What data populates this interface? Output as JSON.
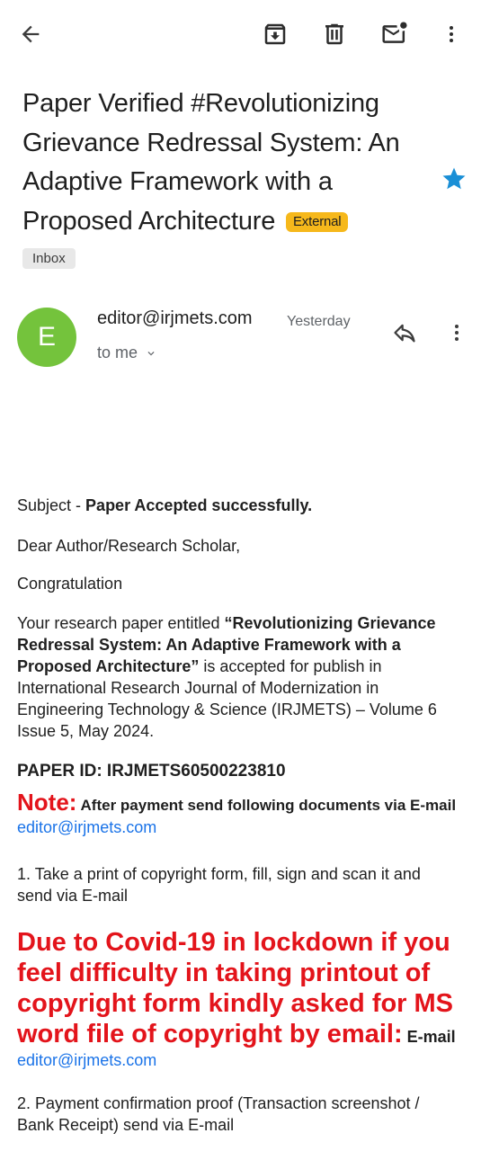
{
  "toolbar": {
    "back_icon": "arrow-back-icon",
    "archive_icon": "archive-icon",
    "delete_icon": "trash-icon",
    "mark_unread_icon": "mail-unread-icon",
    "more_icon": "more-vert-icon"
  },
  "email": {
    "subject": "Paper Verified #Revolutionizing Grievance Redressal System: An Adaptive Framework with a Proposed Architecture",
    "external_label": "External",
    "label_chip": "Inbox",
    "starred": true,
    "star_color": "#1a8fd6"
  },
  "sender": {
    "avatar_letter": "E",
    "avatar_color": "#74c33c",
    "address": "editor@irjmets.com",
    "time": "Yesterday",
    "to": "to me"
  },
  "body": {
    "subject_prefix": "Subject - ",
    "subject_bold": "Paper Accepted successfully.",
    "greeting": "Dear Author/Research Scholar,",
    "congrats": "Congratulation",
    "para_start": "Your research paper entitled ",
    "para_title": "“Revolutionizing Grievance Redressal System: An Adaptive Framework with a Proposed Architecture”",
    "para_end": " is accepted for publish in International Research Journal of Modernization in Engineering Technology & Science (IRJMETS) – Volume 6 Issue 5, May 2024.",
    "paper_id": "PAPER ID: IRJMETS60500223810",
    "note_label": "Note:",
    "note_text": " After payment send following documents via E-mail ",
    "note_email": "editor@irjmets.com",
    "step1": "1. Take a print of copyright form, fill, sign and scan it and send via E-mail",
    "covid_text": "Due to Covid-19 in lockdown if you feel difficulty in taking printout of copyright form kindly asked for MS word file of copyright by email:",
    "covid_suffix": " E-mail",
    "covid_email": "editor@irjmets.com",
    "step2": "2. Payment confirmation proof (Transaction screenshot / Bank Receipt) send via E-mail"
  }
}
